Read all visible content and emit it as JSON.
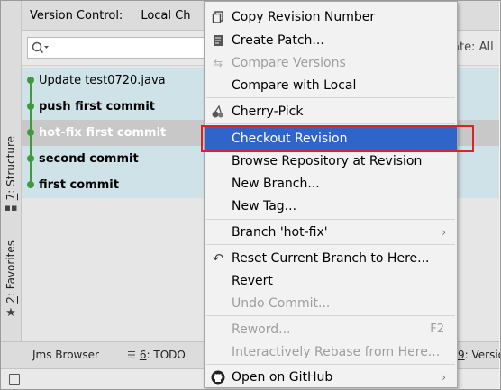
{
  "left_tabs": {
    "structure": {
      "num": "7",
      "text": ": Structure"
    },
    "favorites": {
      "num": "2",
      "text": ": Favorites"
    }
  },
  "panel": {
    "header_title": "Version Control:",
    "header_tab": "Local Ch",
    "search": {
      "placeholder": ""
    },
    "date_filter": "ate: All"
  },
  "commits": [
    {
      "message": "Update test0720.java",
      "bold": false
    },
    {
      "message": "push first commit",
      "bold": true
    },
    {
      "message": "hot-fix first commit",
      "bold": true,
      "selected": true
    },
    {
      "message": "second commit",
      "bold": true
    },
    {
      "message": "first commit",
      "bold": true
    }
  ],
  "bottom_bar": {
    "jms": "Jms Browser",
    "todo_num": "6",
    "todo_text": ": TODO",
    "vcs_num": "9",
    "vcs_text": ": Versio"
  },
  "menu": {
    "items": {
      "copy_revision": "Copy Revision Number",
      "create_patch": "Create Patch...",
      "compare_versions": "Compare Versions",
      "compare_local": "Compare with Local",
      "cherry_pick": "Cherry-Pick",
      "checkout_revision": "Checkout Revision",
      "browse_repo": "Browse Repository at Revision",
      "new_branch": "New Branch...",
      "new_tag": "New Tag...",
      "branch_hotfix": "Branch 'hot-fix'",
      "reset_branch": "Reset Current Branch to Here...",
      "revert": "Revert",
      "undo_commit": "Undo Commit...",
      "reword": "Reword...",
      "reword_shortcut": "F2",
      "interactive_rebase": "Interactively Rebase from Here...",
      "open_github": "Open on GitHub"
    }
  },
  "colors": {
    "highlight": "#2f65ca",
    "commit_row": "#cfe2e8",
    "graph": "#3f9a3f",
    "callout": "#d9232a"
  }
}
